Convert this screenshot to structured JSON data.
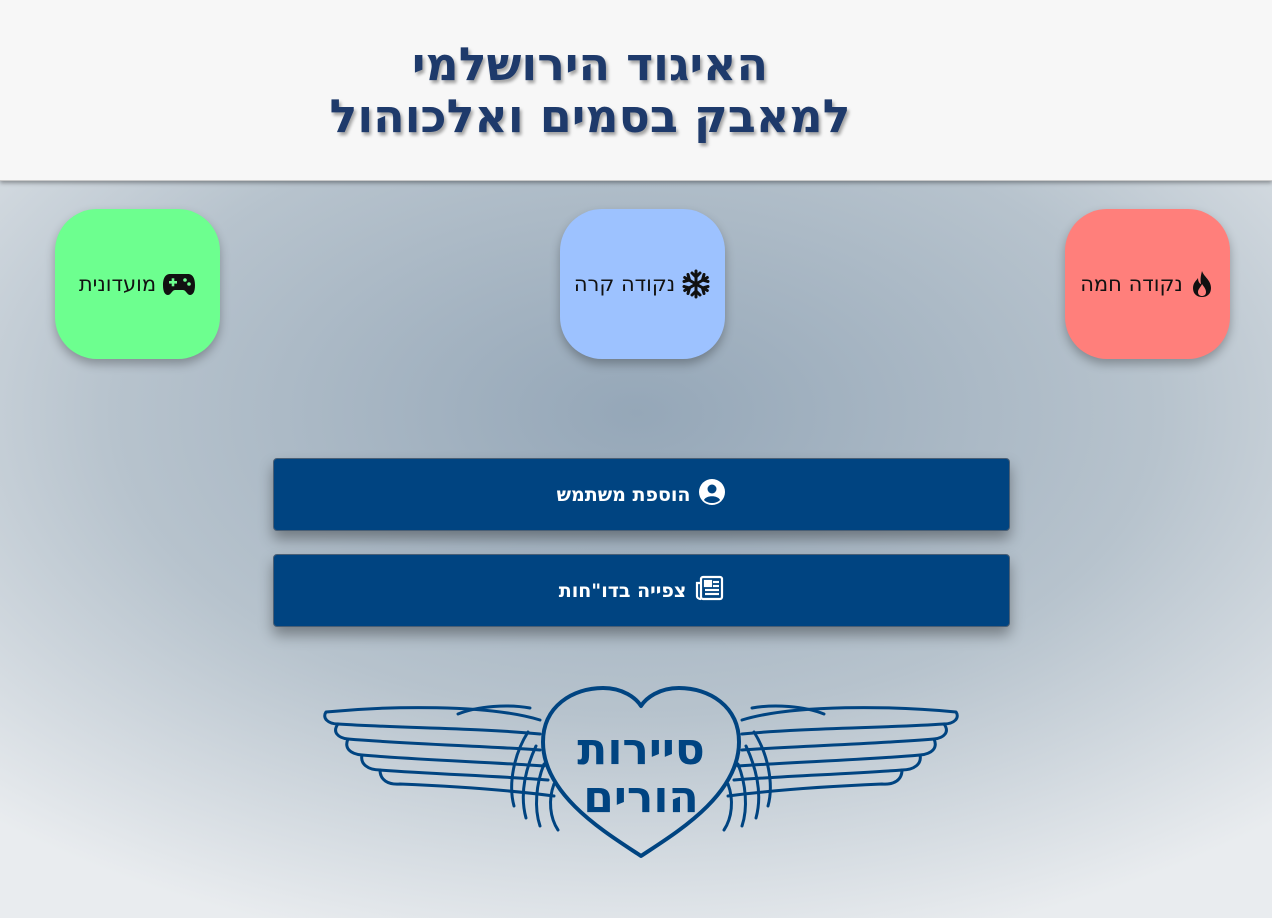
{
  "header": {
    "title_line1": "האיגוד הירושלמי",
    "title_line2": "למאבק בסמים ואלכוהול"
  },
  "tiles": [
    {
      "label": "נקודה חמה",
      "icon": "fire-icon",
      "color": "#ff7f7b"
    },
    {
      "label": "נקודה קרה",
      "icon": "snowflake-icon",
      "color": "#9dc2ff"
    },
    {
      "label": "מועדונית",
      "icon": "gamepad-icon",
      "color": "#6dff8f"
    }
  ],
  "actions": {
    "add_user_label": "הוספת משתמש",
    "add_user_icon": "user-circle-icon",
    "view_reports_label": "צפייה בדו\"חות",
    "view_reports_icon": "newspaper-icon"
  },
  "logo": {
    "line1": "סיירות",
    "line2": "הורים"
  },
  "colors": {
    "header_text": "#1e3a6b",
    "button_bg": "#004481",
    "logo": "#004481"
  }
}
